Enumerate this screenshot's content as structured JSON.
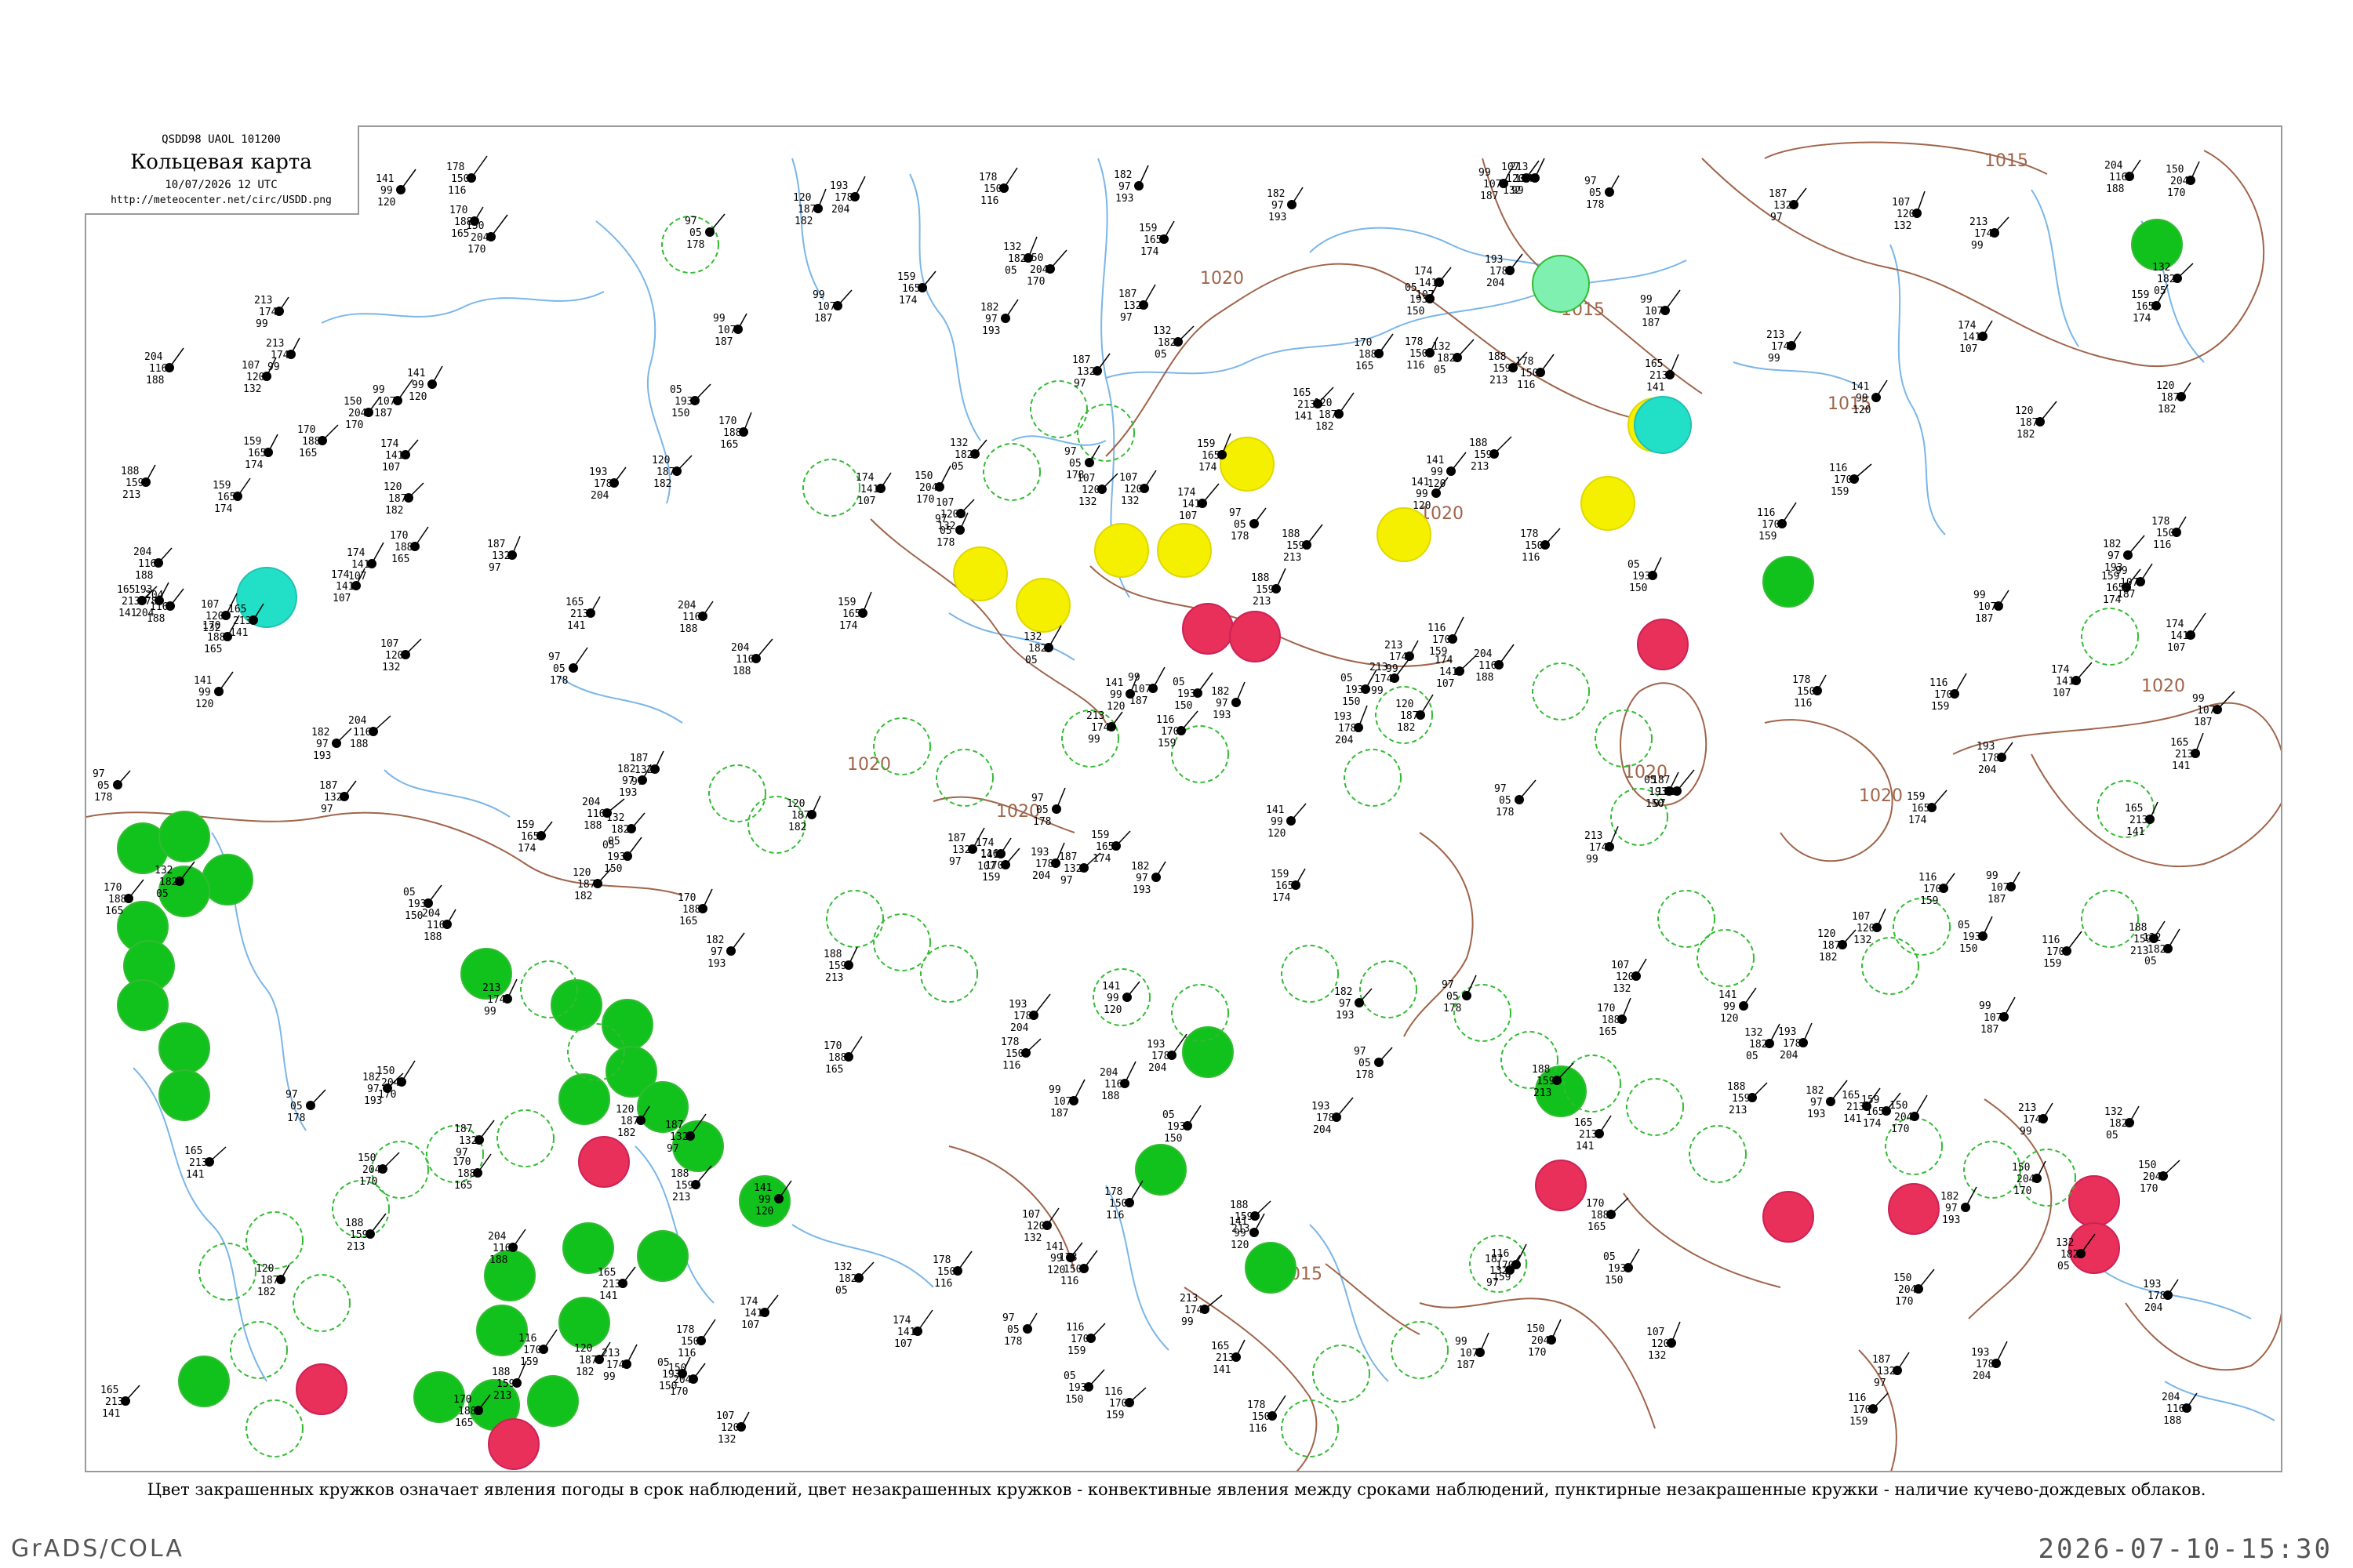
{
  "header": {
    "codes": "QSDD98  UAOL  101200",
    "title": "Кольцевая карта",
    "datetime": "10/07/2026 12 UTC",
    "url": "http://meteocenter.net/circ/USDD.png"
  },
  "isobars": [
    "1015",
    "1020",
    "1020",
    "1020",
    "1015",
    "1020",
    "1020",
    "1020",
    "1015",
    "1020",
    "1015"
  ],
  "station_values": [
    "182",
    "97",
    "05",
    "193",
    "178",
    "150",
    "204",
    "116",
    "170",
    "188",
    "159",
    "165",
    "213",
    "174",
    "141",
    "99",
    "107",
    "120",
    "187",
    "132"
  ],
  "legend_text": "Цвет закрашенных кружков означает явления погоды в срок наблюдений, цвет незакрашенных кружков - конвективные явления между сроками наблюдений, пунктирные незакрашенные кружки - наличие кучево-дождевых облаков.",
  "footer": {
    "left": "GrADS/COLA",
    "right": "2026-07-10-15:30"
  },
  "colors": {
    "green_fill": "#11c21d",
    "red_fill": "#e8305a",
    "yellow_fill": "#f5f000",
    "cyan_fill": "#22e0c8",
    "isobar": "#a0644a",
    "water": "#7bb6e8",
    "outline_green": "#33bb33"
  }
}
